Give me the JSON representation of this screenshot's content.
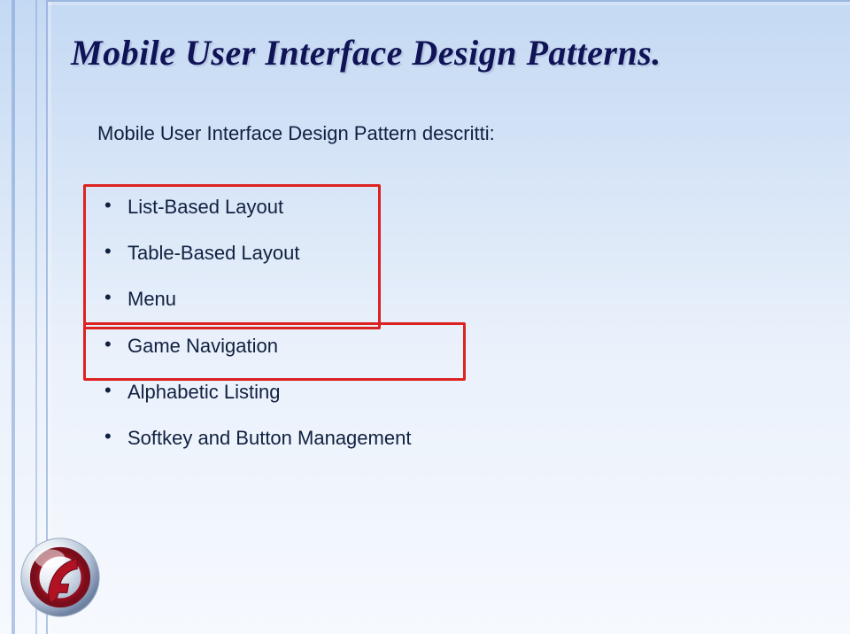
{
  "title": "Mobile User Interface Design Patterns.",
  "subtitle": "Mobile User Interface Design Pattern descritti:",
  "bullets": {
    "b0": "List-Based Layout",
    "b1": "Table-Based Layout",
    "b2": "Menu",
    "b3": "Game Navigation",
    "b4": "Alphabetic Listing",
    "b5": "Softkey and Button Management"
  },
  "icon": "flash-logo"
}
